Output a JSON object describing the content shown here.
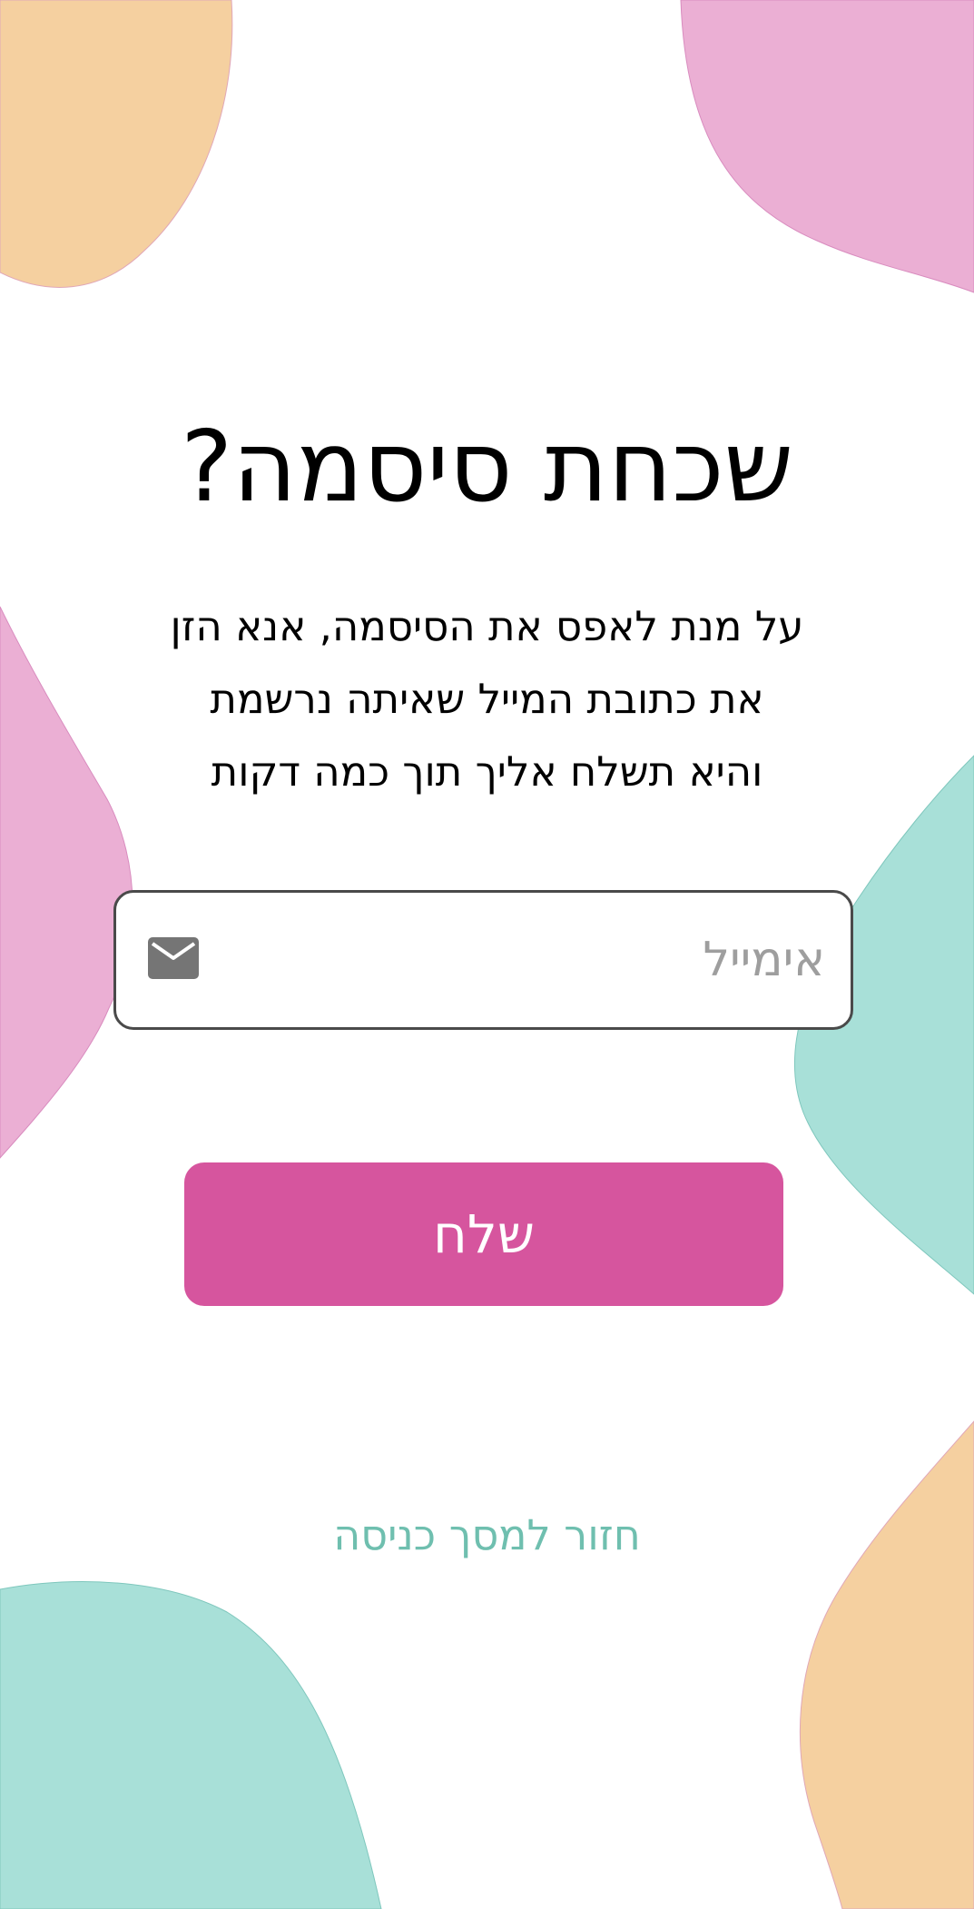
{
  "page": {
    "title": "שכחת סיסמה?",
    "description_lines": [
      "על מנת לאפס את הסיסמה, אנא הזן",
      "את כתובת המייל שאיתה נרשמת",
      "והיא תשלח אליך תוך כמה דקות"
    ]
  },
  "email": {
    "placeholder": "אימייל",
    "value": "",
    "icon": "mail-icon"
  },
  "actions": {
    "submit_label": "שלח",
    "back_link_label": "חזור למסך כניסה"
  },
  "colors": {
    "submit_button": "#d6559e",
    "back_link": "#6fbfaf",
    "blob_pink": "#ebafd4",
    "blob_orange": "#f5d0a0",
    "blob_teal": "#a8e0d8"
  }
}
